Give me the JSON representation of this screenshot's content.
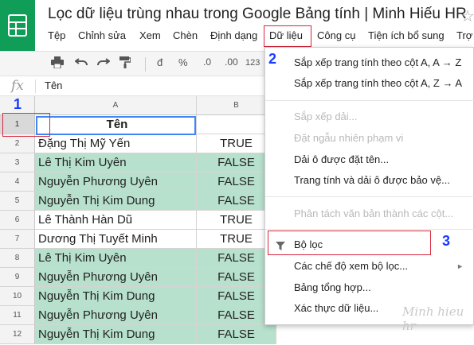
{
  "header": {
    "title": "Lọc dữ liệu trùng nhau trong Google Bảng tính | Minh Hiếu HR",
    "star": "☆"
  },
  "menu": [
    "Tệp",
    "Chỉnh sửa",
    "Xem",
    "Chèn",
    "Định dạng",
    "Dữ liệu",
    "Công cụ",
    "Tiện ích bổ sung",
    "Trợ"
  ],
  "toolbar": {
    "currency": "đ",
    "percent": "%",
    "dec_decrease": ".0",
    "dec_increase": ".00",
    "number_format": "123"
  },
  "formula_bar": {
    "fx": "fx",
    "value": "Tên"
  },
  "columns": [
    "A",
    "B"
  ],
  "rows": [
    {
      "n": "1",
      "a": "Tên",
      "b": "",
      "green": false,
      "header": true
    },
    {
      "n": "2",
      "a": "Đặng Thị Mỹ Yến",
      "b": "TRUE",
      "green": false
    },
    {
      "n": "3",
      "a": "Lê Thị Kim Uyên",
      "b": "FALSE",
      "green": true
    },
    {
      "n": "4",
      "a": "Nguyễn Phương Uyên",
      "b": "FALSE",
      "green": true
    },
    {
      "n": "5",
      "a": "Nguyễn Thị Kim Dung",
      "b": "FALSE",
      "green": true
    },
    {
      "n": "6",
      "a": "Lê Thành Hàn Dũ",
      "b": "TRUE",
      "green": false
    },
    {
      "n": "7",
      "a": "Dương Thị Tuyết Minh",
      "b": "TRUE",
      "green": false
    },
    {
      "n": "8",
      "a": "Lê Thị Kim Uyên",
      "b": "FALSE",
      "green": true
    },
    {
      "n": "9",
      "a": "Nguyễn Phương Uyên",
      "b": "FALSE",
      "green": true
    },
    {
      "n": "10",
      "a": "Nguyễn Thị Kim Dung",
      "b": "FALSE",
      "green": true
    },
    {
      "n": "11",
      "a": "Nguyễn Phương Uyên",
      "b": "FALSE",
      "green": true
    },
    {
      "n": "12",
      "a": "Nguyễn Thị Kim Dung",
      "b": "FALSE",
      "green": true
    }
  ],
  "data_menu": {
    "sort_az": "Sắp xếp trang tính theo cột A, A → Z",
    "sort_za": "Sắp xếp trang tính theo cột A, Z → A",
    "sort_range": "Sắp xếp dải...",
    "randomize": "Đặt ngẫu nhiên phạm vi",
    "named_ranges": "Dải ô được đặt tên...",
    "protected": "Trang tính và dải ô được bảo vệ...",
    "split_text": "Phân tách văn bản thành các cột...",
    "filter": "Bộ lọc",
    "filter_views": "Các chế độ xem bộ lọc...",
    "pivot": "Bảng tổng hợp...",
    "validation": "Xác thực dữ liệu...",
    "submenu_arrow": "►"
  },
  "annotations": {
    "step1": "1",
    "step2": "2",
    "step3": "3"
  },
  "watermark": "Minh hieu hr",
  "colors": {
    "logo_green": "#0f9d58",
    "highlight_green": "#b7e1cd",
    "annotation_red": "#d7263d",
    "annotation_blue": "#1a3cff",
    "selection_blue": "#4285f4"
  }
}
